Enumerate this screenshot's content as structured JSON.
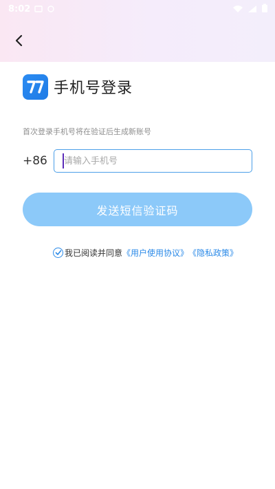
{
  "status_bar": {
    "time": "8:02"
  },
  "header": {
    "back_icon": "chevron-left-icon"
  },
  "title": {
    "logo_icon": "app-logo-icon",
    "text": "手机号登录"
  },
  "hint": "首次登录手机号将在验证后生成新账号",
  "phone": {
    "country_code": "+86",
    "placeholder": "请输入手机号",
    "value": ""
  },
  "send_button": {
    "label": "发送短信验证码"
  },
  "agreement": {
    "prefix": "我已阅读并同意",
    "user_agreement": "《用户使用协议》",
    "privacy_policy": "《隐私政策》",
    "checked": true
  },
  "colors": {
    "accent": "#2b8ae8",
    "button_bg": "#8cc9f9",
    "input_border": "#4a9ee8",
    "logo_bg": "#1e7be6"
  }
}
